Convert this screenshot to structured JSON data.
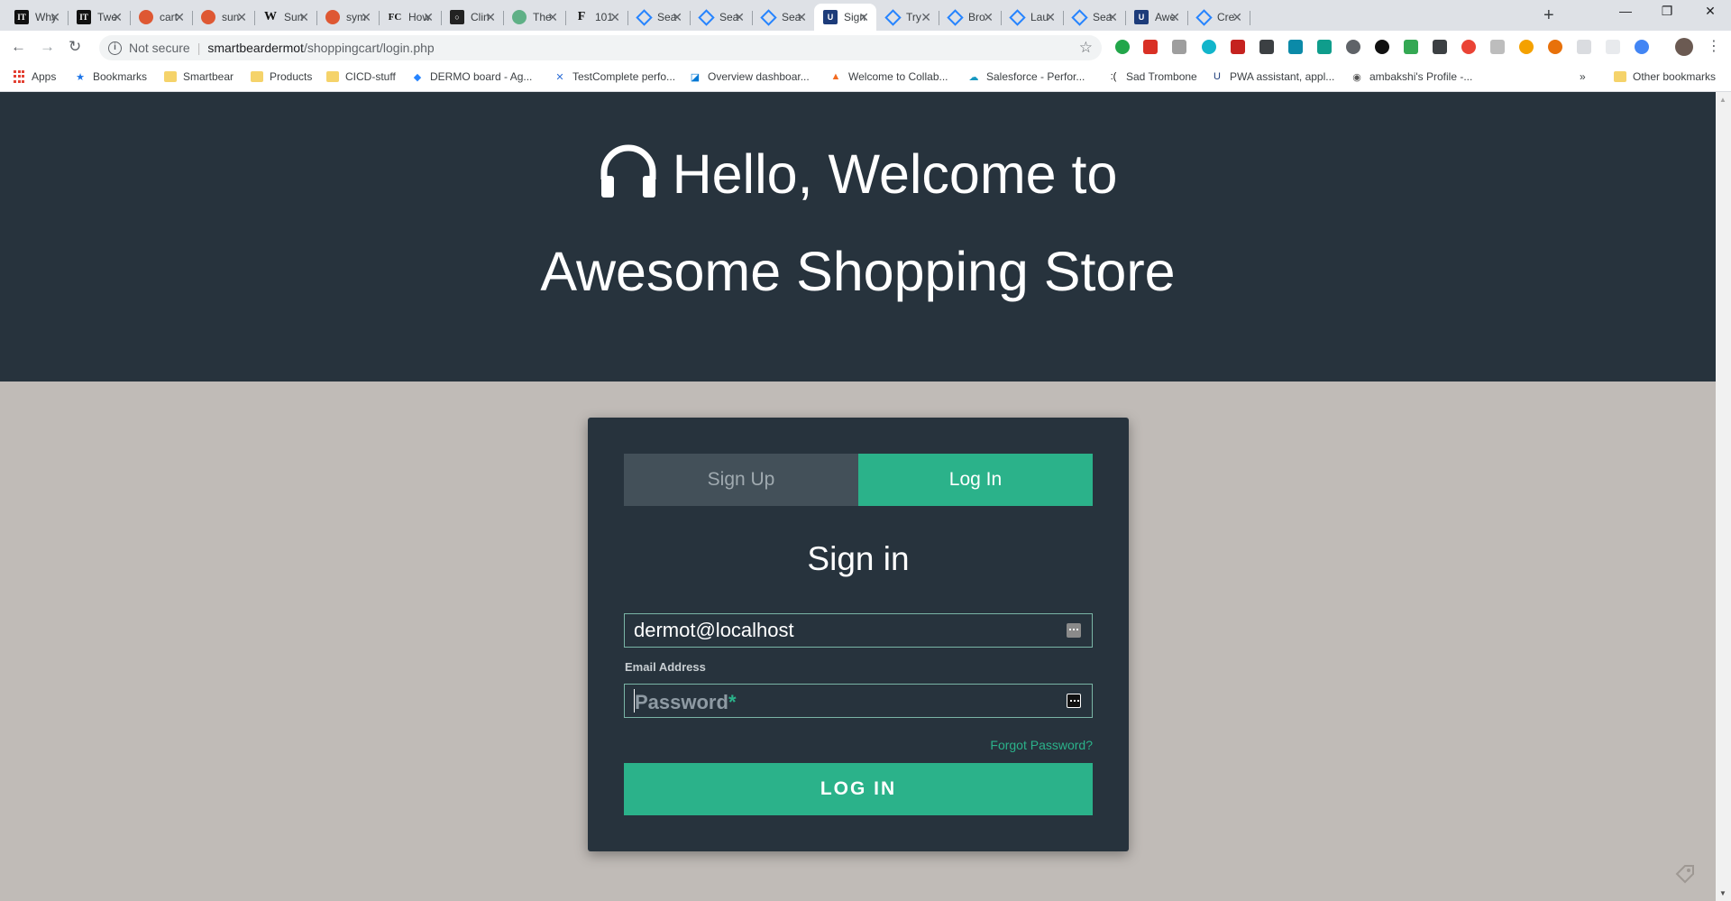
{
  "browser": {
    "tabs": [
      {
        "title": "Why",
        "favicon": "it-icon"
      },
      {
        "title": "Twe",
        "favicon": "it-icon"
      },
      {
        "title": "cart",
        "favicon": "duckduckgo-icon"
      },
      {
        "title": "sun",
        "favicon": "duckduckgo-icon"
      },
      {
        "title": "Sun",
        "favicon": "wikipedia-icon"
      },
      {
        "title": "sym",
        "favicon": "duckduckgo-icon"
      },
      {
        "title": "How",
        "favicon": "fc-icon"
      },
      {
        "title": "Clin",
        "favicon": "circle-icon"
      },
      {
        "title": "The",
        "favicon": "green-icon"
      },
      {
        "title": "101",
        "favicon": "f-icon"
      },
      {
        "title": "Sea",
        "favicon": "jira-icon"
      },
      {
        "title": "Sea",
        "favicon": "jira-icon"
      },
      {
        "title": "Sea",
        "favicon": "jira-icon"
      },
      {
        "title": "Sign",
        "favicon": "u-icon",
        "active": true
      },
      {
        "title": "Try",
        "favicon": "jira-icon"
      },
      {
        "title": "Bro",
        "favicon": "jira-icon"
      },
      {
        "title": "Lau",
        "favicon": "jira-icon"
      },
      {
        "title": "Sea",
        "favicon": "jira-icon"
      },
      {
        "title": "Awe",
        "favicon": "u-icon"
      },
      {
        "title": "Cre",
        "favicon": "jira-icon"
      }
    ],
    "address": {
      "security": "Not secure",
      "host": "smartbeardermot",
      "path": "/shoppingcart/login.php"
    },
    "bookmarks": [
      {
        "label": "Apps",
        "icon": "apps-grid-icon"
      },
      {
        "label": "Bookmarks",
        "icon": "star-icon"
      },
      {
        "label": "Smartbear",
        "icon": "folder-icon"
      },
      {
        "label": "Products",
        "icon": "folder-icon"
      },
      {
        "label": "CICD-stuff",
        "icon": "folder-icon"
      },
      {
        "label": "DERMO board - Ag...",
        "icon": "jira-icon"
      },
      {
        "label": "TestComplete perfo...",
        "icon": "testcomplete-icon"
      },
      {
        "label": "Overview dashboar...",
        "icon": "azure-icon"
      },
      {
        "label": "Welcome to Collab...",
        "icon": "collab-icon"
      },
      {
        "label": "Salesforce - Perfor...",
        "icon": "salesforce-icon"
      },
      {
        "label": "Sad Trombone",
        "icon": "sad-icon"
      },
      {
        "label": "PWA assistant, appl...",
        "icon": "pwa-icon"
      },
      {
        "label": "ambakshi's Profile -...",
        "icon": "profile-icon"
      }
    ],
    "other_bookmarks": "Other bookmarks",
    "overflow": "»"
  },
  "hero": {
    "line1": "Hello, Welcome to",
    "line2": "Awesome Shopping Store",
    "icon": "headphones-icon"
  },
  "login_card": {
    "tab_signup": "Sign Up",
    "tab_login": "Log In",
    "title": "Sign in",
    "email_value": "dermot@localhost",
    "email_label": "Email Address",
    "password_placeholder": "Password",
    "password_required_mark": "*",
    "forgot": "Forgot Password?",
    "submit": "LOG IN"
  },
  "colors": {
    "hero_bg": "#27333d",
    "page_bg": "#c0bbb7",
    "accent": "#2bb28a",
    "tab_inactive": "#435059"
  }
}
